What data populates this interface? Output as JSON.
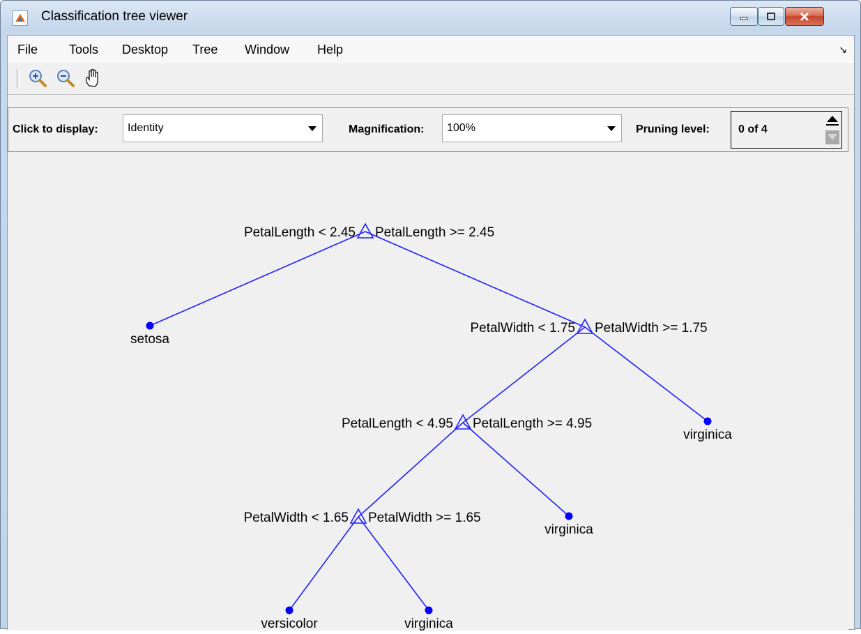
{
  "window": {
    "title": "Classification tree viewer"
  },
  "menu": {
    "file": "File",
    "tools": "Tools",
    "desktop": "Desktop",
    "tree": "Tree",
    "window": "Window",
    "help": "Help"
  },
  "toolbar": {
    "zoom_in": "zoom-in-icon",
    "zoom_out": "zoom-out-icon",
    "pan": "pan-hand-icon"
  },
  "controls": {
    "display_label": "Click to display:",
    "display_value": "Identity",
    "magnification_label": "Magnification:",
    "magnification_value": "100%",
    "pruning_label": "Pruning level:",
    "pruning_value": "0 of 4"
  },
  "tree": {
    "line_color": "#1f1fff",
    "node_color": "#0000ff",
    "nodes": [
      {
        "id": "n1",
        "type": "split",
        "left_rule": "PetalLength < 2.45",
        "right_rule": "PetalLength >= 2.45"
      },
      {
        "id": "n2",
        "type": "leaf",
        "label": "setosa"
      },
      {
        "id": "n3",
        "type": "split",
        "left_rule": "PetalWidth < 1.75",
        "right_rule": "PetalWidth >= 1.75"
      },
      {
        "id": "n4",
        "type": "split",
        "left_rule": "PetalLength < 4.95",
        "right_rule": "PetalLength >= 4.95"
      },
      {
        "id": "n5",
        "type": "leaf",
        "label": "virginica"
      },
      {
        "id": "n6",
        "type": "split",
        "left_rule": "PetalWidth < 1.65",
        "right_rule": "PetalWidth >= 1.65"
      },
      {
        "id": "n7",
        "type": "leaf",
        "label": "virginica"
      },
      {
        "id": "n8",
        "type": "leaf",
        "label": "versicolor"
      },
      {
        "id": "n9",
        "type": "leaf",
        "label": "virginica"
      }
    ]
  }
}
